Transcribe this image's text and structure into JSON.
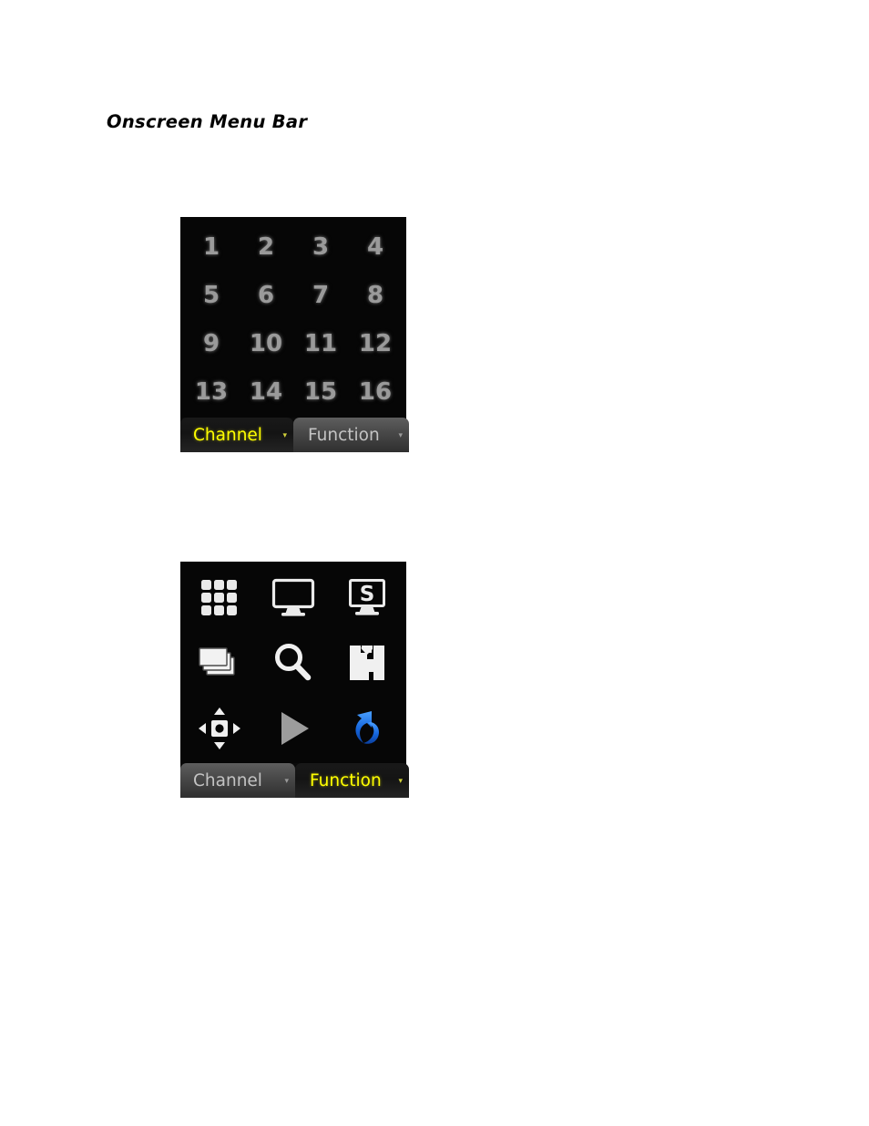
{
  "page": {
    "heading": "Onscreen Menu Bar",
    "background_color": "#ffffff"
  },
  "colors": {
    "panel_background": "#060606",
    "active_tab_text": "#ffff00",
    "inactive_tab_text": "#c3c3c3",
    "channel_number_text": "#9a9a9a",
    "icon_white": "#f0f0f0",
    "play_icon_gray": "#9a9a9a",
    "exit_icon_blue": "#1166dd"
  },
  "panels": [
    {
      "name": "channel-panel",
      "active_tab": "Channel",
      "channels": [
        "1",
        "2",
        "3",
        "4",
        "5",
        "6",
        "7",
        "8",
        "9",
        "10",
        "11",
        "12",
        "13",
        "14",
        "15",
        "16"
      ],
      "tabs": [
        {
          "label": "Channel",
          "caret": "▾",
          "active": true
        },
        {
          "label": "Function",
          "caret": "▾",
          "active": false
        }
      ]
    },
    {
      "name": "function-panel",
      "active_tab": "Function",
      "icons": [
        {
          "name": "split-screen-icon",
          "label": "Split Screen"
        },
        {
          "name": "monitor-icon",
          "label": "Monitor"
        },
        {
          "name": "sequence-monitor-icon",
          "label": "Sequence",
          "glyph": "S"
        },
        {
          "name": "layers-icon",
          "label": "Layers"
        },
        {
          "name": "search-icon",
          "label": "Search"
        },
        {
          "name": "backup-icon",
          "label": "Backup"
        },
        {
          "name": "ptz-icon",
          "label": "PTZ"
        },
        {
          "name": "play-icon",
          "label": "Playback"
        },
        {
          "name": "exit-icon",
          "label": "Exit"
        }
      ],
      "tabs": [
        {
          "label": "Channel",
          "caret": "▾",
          "active": false
        },
        {
          "label": "Function",
          "caret": "▾",
          "active": true
        }
      ]
    }
  ]
}
